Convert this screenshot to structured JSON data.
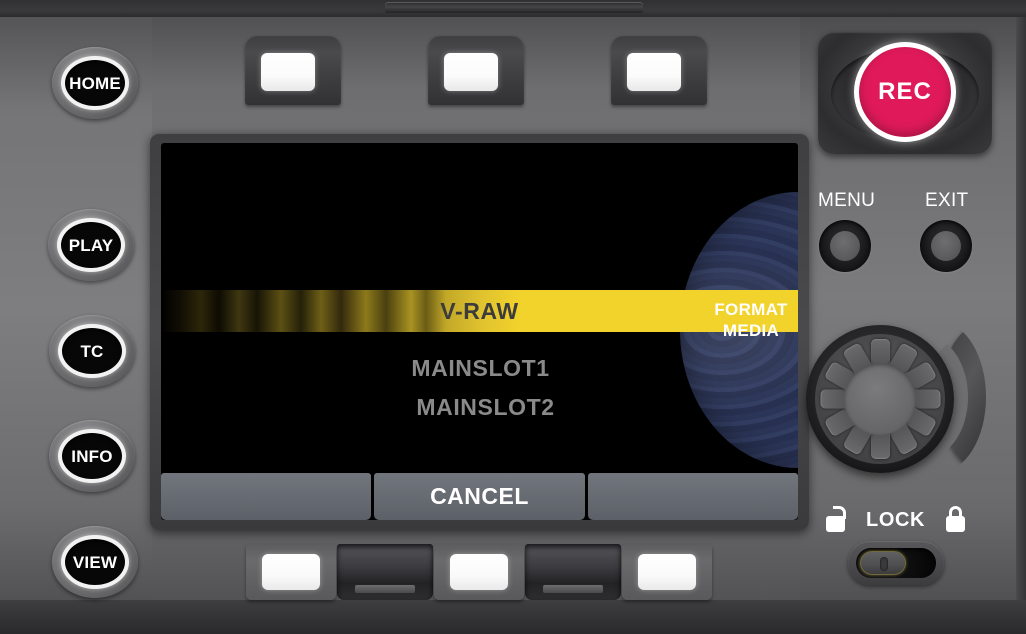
{
  "device": {
    "name": "camera-recorder-control-panel",
    "body_color": "#7a7a7c",
    "rail_color": "#333335"
  },
  "left_buttons": [
    {
      "label": "HOME",
      "name": "home-button"
    },
    {
      "label": "PLAY",
      "name": "play-button"
    },
    {
      "label": "TC",
      "name": "tc-button"
    },
    {
      "label": "INFO",
      "name": "info-button"
    },
    {
      "label": "VIEW",
      "name": "view-button"
    }
  ],
  "rec": {
    "label": "REC",
    "color": "#e01a5a",
    "ring_color": "#ffffff"
  },
  "knobs": [
    {
      "label": "MENU",
      "name": "menu-knob"
    },
    {
      "label": "EXIT",
      "name": "exit-knob"
    }
  ],
  "lock": {
    "label": "LOCK",
    "state": "unlocked",
    "open_icon": "padlock-open-icon",
    "closed_icon": "padlock-closed-icon"
  },
  "jog": {
    "name": "jog-dial",
    "teeth": 12,
    "shuttle_ring": "shuttle-ring"
  },
  "soft_keys_top": [
    {
      "name": "soft-key-top-1"
    },
    {
      "name": "soft-key-top-2"
    },
    {
      "name": "soft-key-top-3"
    }
  ],
  "soft_keys_bottom": [
    {
      "type": "button",
      "name": "soft-key-bottom-1"
    },
    {
      "type": "slot",
      "name": "card-slot-1"
    },
    {
      "type": "button",
      "name": "soft-key-bottom-2"
    },
    {
      "type": "slot",
      "name": "card-slot-2"
    },
    {
      "type": "button",
      "name": "soft-key-bottom-3"
    }
  ],
  "lcd": {
    "top_tabs": [
      {
        "label": "",
        "name": "lcd-tab-top-left"
      },
      {
        "label": "",
        "name": "lcd-tab-top-center"
      },
      {
        "label": "",
        "name": "lcd-tab-top-right"
      }
    ],
    "bottom_tabs": [
      {
        "label": "",
        "name": "lcd-tab-bottom-left"
      },
      {
        "label": "CANCEL",
        "name": "lcd-tab-cancel"
      },
      {
        "label": "",
        "name": "lcd-tab-bottom-right"
      }
    ],
    "screen_title": "FORMAT\nMEDIA",
    "format_media_line1": "FORMAT",
    "format_media_line2": "MEDIA",
    "menu_items": [
      {
        "label": "V-RAW",
        "selected": true,
        "name": "menu-item-v-raw"
      },
      {
        "label": "MAINSLOT1",
        "selected": false,
        "name": "menu-item-mainslot1"
      },
      {
        "label": "MAINSLOT2",
        "selected": false,
        "name": "menu-item-mainslot2"
      }
    ],
    "colors": {
      "background": "#000000",
      "highlight": "#f2d32b",
      "highlight_text": "#3c3c3c",
      "item_text": "#8a8a8a",
      "tab_bg": "#666a71",
      "tab_text": "#ffffff",
      "arc_blue": "#2b3557"
    }
  }
}
